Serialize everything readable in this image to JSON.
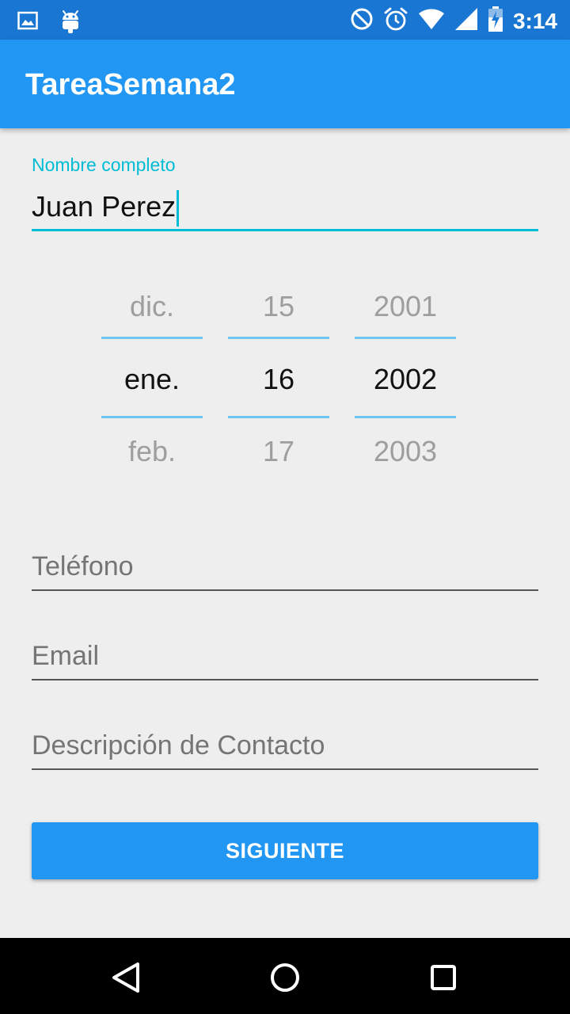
{
  "status_bar": {
    "time": "3:14",
    "left_icons": [
      "image-icon",
      "android-icon"
    ],
    "right_icons": [
      "do-not-disturb-icon",
      "alarm-icon",
      "wifi-icon",
      "signal-icon",
      "battery-charging-icon"
    ]
  },
  "app_bar": {
    "title": "TareaSemana2"
  },
  "form": {
    "name_label": "Nombre completo",
    "name_value": "Juan Perez",
    "date_picker": {
      "month": {
        "prev": "dic.",
        "selected": "ene.",
        "next": "feb."
      },
      "day": {
        "prev": "15",
        "selected": "16",
        "next": "17"
      },
      "year": {
        "prev": "2001",
        "selected": "2002",
        "next": "2003"
      }
    },
    "phone_placeholder": "Teléfono",
    "email_placeholder": "Email",
    "description_placeholder": "Descripción de Contacto",
    "submit_label": "SIGUIENTE"
  },
  "nav_bar": {
    "icons": [
      "back-icon",
      "home-icon",
      "recents-icon"
    ]
  },
  "colors": {
    "primary": "#2196f3",
    "primary_dark": "#1976d2",
    "accent": "#00bcd4"
  }
}
